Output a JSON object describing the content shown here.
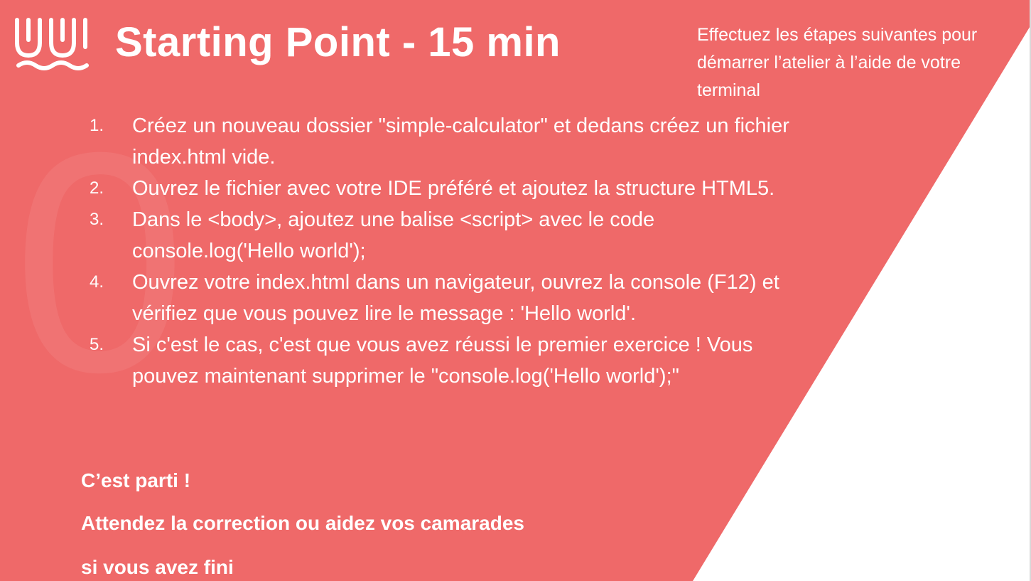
{
  "colors": {
    "background": "#ef6969",
    "text": "#ffffff",
    "right_panel": "#ffffff"
  },
  "logo": {
    "icon": "wild-code-school-logo-icon"
  },
  "header": {
    "title": "Starting Point - 15 min",
    "subtitle": "Effectuez les étapes suivantes pour démarrer l’atelier à l’aide de votre terminal"
  },
  "watermark": {
    "glyph": "0"
  },
  "steps": [
    {
      "number": "1.",
      "text": "Créez un nouveau dossier \"simple-calculator\" et dedans créez un fichier index.html vide."
    },
    {
      "number": "2.",
      "text": "Ouvrez le fichier avec votre IDE préféré et ajoutez la structure HTML5."
    },
    {
      "number": "3.",
      "text": "Dans le <body>, ajoutez une balise <script> avec le code console.log('Hello world');"
    },
    {
      "number": "4.",
      "text": "Ouvrez votre index.html dans un navigateur, ouvrez la console (F12) et vérifiez que vous pouvez lire le message : 'Hello world'."
    },
    {
      "number": "5.",
      "text": "Si c'est le cas, c'est que vous avez réussi le premier exercice ! Vous pouvez maintenant supprimer le \"console.log('Hello world');\""
    }
  ],
  "footer": {
    "line1": "C’est parti !",
    "line2": "Attendez la correction ou aidez vos camarades",
    "line3": "si vous avez fini"
  }
}
